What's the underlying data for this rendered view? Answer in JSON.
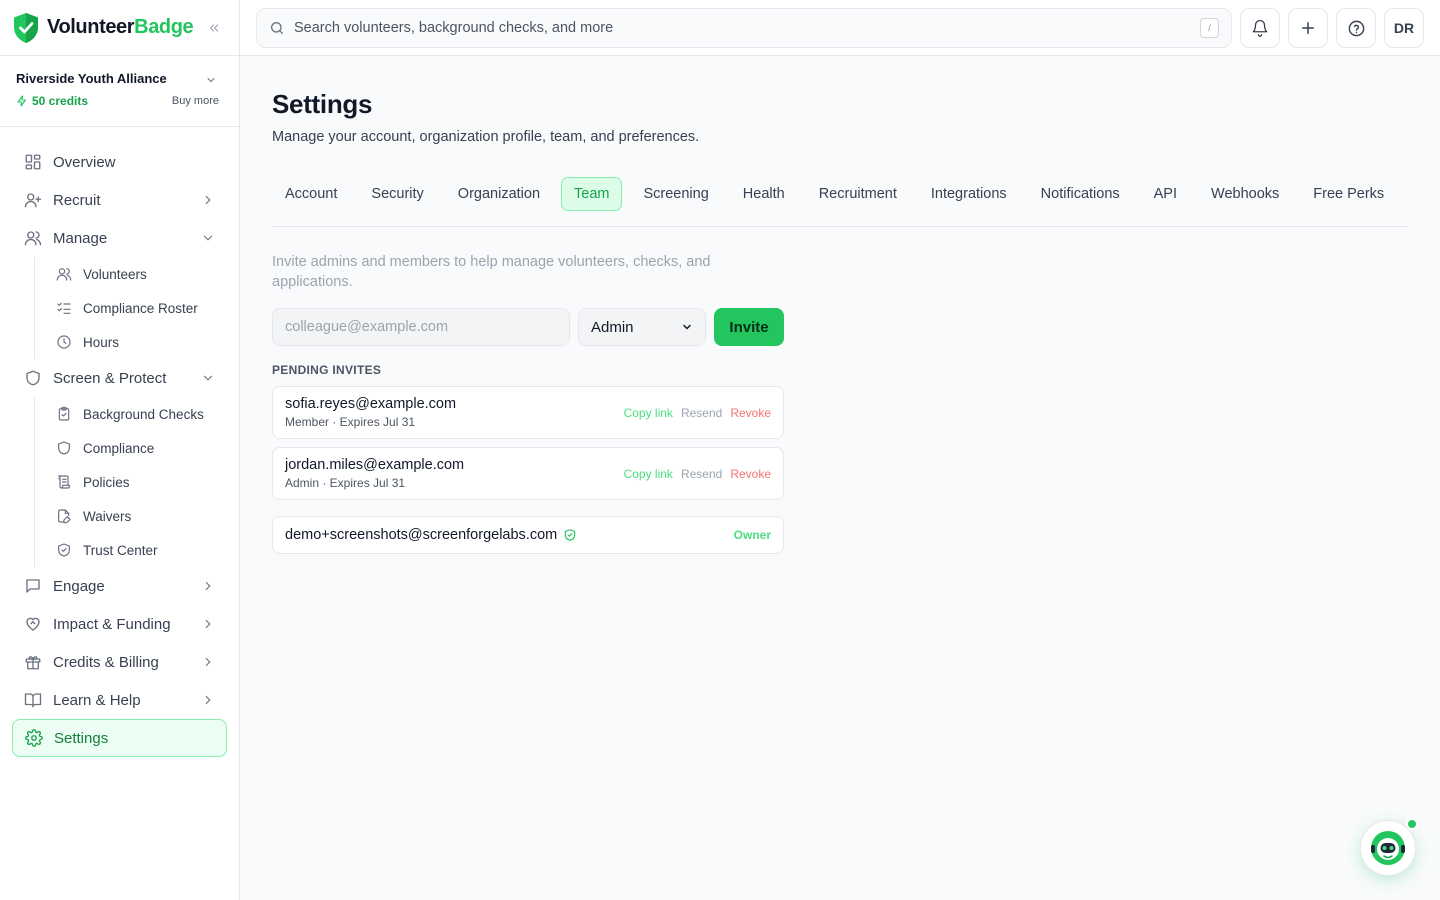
{
  "brand": {
    "name_part1": "Volunteer",
    "name_part2": "Badge",
    "accent_color": "#22c55e"
  },
  "org": {
    "name": "Riverside Youth Alliance",
    "credits": "50 credits",
    "buy_more": "Buy more"
  },
  "sidebar": {
    "items": [
      {
        "label": "Overview",
        "icon": "grid-icon"
      },
      {
        "label": "Recruit",
        "icon": "user-plus-icon",
        "expandable": true
      },
      {
        "label": "Manage",
        "icon": "users-icon",
        "expanded": true,
        "children": [
          {
            "label": "Volunteers",
            "icon": "users-icon"
          },
          {
            "label": "Compliance Roster",
            "icon": "list-checks-icon"
          },
          {
            "label": "Hours",
            "icon": "clock-icon"
          }
        ]
      },
      {
        "label": "Screen & Protect",
        "icon": "shield-icon",
        "expanded": true,
        "children": [
          {
            "label": "Background Checks",
            "icon": "clipboard-check-icon"
          },
          {
            "label": "Compliance",
            "icon": "shield-icon"
          },
          {
            "label": "Policies",
            "icon": "scroll-icon"
          },
          {
            "label": "Waivers",
            "icon": "file-pen-icon"
          },
          {
            "label": "Trust Center",
            "icon": "shield-check-icon"
          }
        ]
      },
      {
        "label": "Engage",
        "icon": "message-square-icon",
        "expandable": true
      },
      {
        "label": "Impact & Funding",
        "icon": "heart-handshake-icon",
        "expandable": true
      },
      {
        "label": "Credits & Billing",
        "icon": "gift-icon",
        "expandable": true
      },
      {
        "label": "Learn & Help",
        "icon": "book-open-icon",
        "expandable": true
      },
      {
        "label": "Settings",
        "icon": "gear-icon",
        "active": true
      }
    ]
  },
  "topbar": {
    "search_placeholder": "Search volunteers, background checks, and more",
    "search_shortcut": "/",
    "avatar_initials": "DR"
  },
  "page": {
    "title": "Settings",
    "subtitle": "Manage your account, organization profile, team, and preferences."
  },
  "tabs": [
    "Account",
    "Security",
    "Organization",
    "Team",
    "Screening",
    "Health",
    "Recruitment",
    "Integrations",
    "Notifications",
    "API",
    "Webhooks",
    "Free Perks"
  ],
  "active_tab": "Team",
  "team": {
    "description": "Invite admins and members to help manage volunteers, checks, and applications.",
    "email_placeholder": "colleague@example.com",
    "role_value": "Admin",
    "invite_label": "Invite",
    "pending_label": "PENDING INVITES",
    "pending": [
      {
        "email": "sofia.reyes@example.com",
        "meta": "Member · Expires Jul 31",
        "copy": "Copy link",
        "resend": "Resend",
        "revoke": "Revoke"
      },
      {
        "email": "jordan.miles@example.com",
        "meta": "Admin · Expires Jul 31",
        "copy": "Copy link",
        "resend": "Resend",
        "revoke": "Revoke"
      }
    ],
    "owner": {
      "email": "demo+screenshots@screenforgelabs.com",
      "badge": "Owner"
    }
  }
}
